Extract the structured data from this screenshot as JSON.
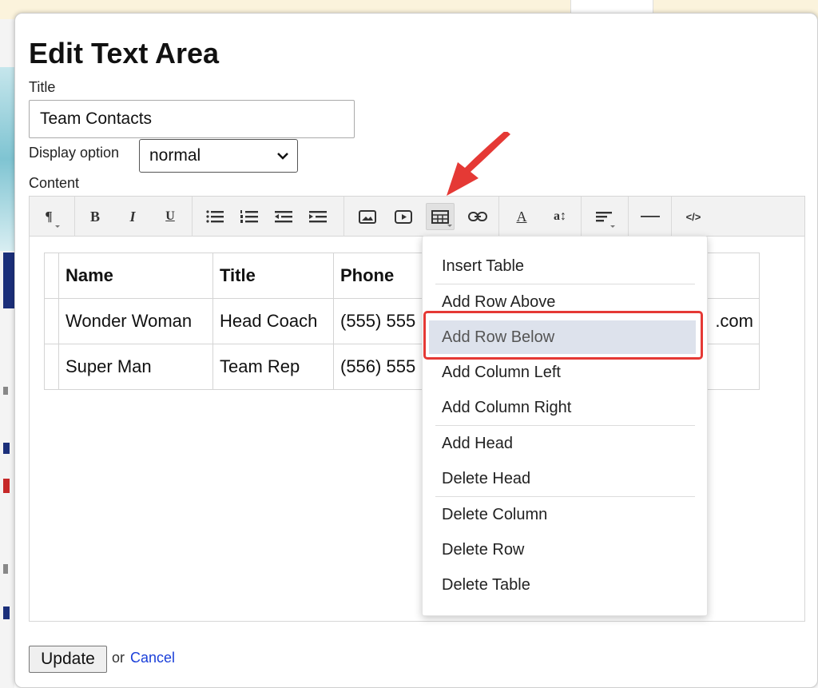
{
  "dialog": {
    "heading": "Edit Text Area",
    "title_label": "Title",
    "title_value": "Team Contacts",
    "display_label": "Display option",
    "display_value": "normal",
    "content_label": "Content"
  },
  "toolbar": {
    "icons": [
      "paragraph-icon",
      "bold-icon",
      "italic-icon",
      "underline-icon",
      "bullet-list-icon",
      "numbered-list-icon",
      "outdent-icon",
      "indent-icon",
      "image-icon",
      "video-icon",
      "table-icon",
      "link-icon",
      "font-color-icon",
      "font-size-icon",
      "align-icon",
      "horizontal-rule-icon",
      "code-view-icon"
    ],
    "bold": "B",
    "italic": "I",
    "underline": "U",
    "paragraph": "¶",
    "font_color": "A",
    "font_size": "a↕",
    "code": "</>"
  },
  "table": {
    "headers": [
      "Name",
      "Title",
      "Phone",
      ""
    ],
    "rows": [
      [
        "Wonder Woman",
        "Head Coach",
        "(555) 555",
        ".com"
      ],
      [
        "Super Man",
        "Team Rep",
        "(556) 555",
        ""
      ]
    ]
  },
  "table_menu": {
    "items": [
      "Insert Table",
      "Add Row Above",
      "Add Row Below",
      "Add Column Left",
      "Add Column Right",
      "Add Head",
      "Delete Head",
      "Delete Column",
      "Delete Row",
      "Delete Table"
    ],
    "highlighted": "Add Row Below"
  },
  "footer": {
    "update_label": "Update",
    "or_text": "or",
    "cancel_label": "Cancel"
  },
  "colors": {
    "highlight_border": "#e53935",
    "arrow": "#e53935",
    "link": "#1a3fd9",
    "menu_highlight": "#dde2ec"
  }
}
